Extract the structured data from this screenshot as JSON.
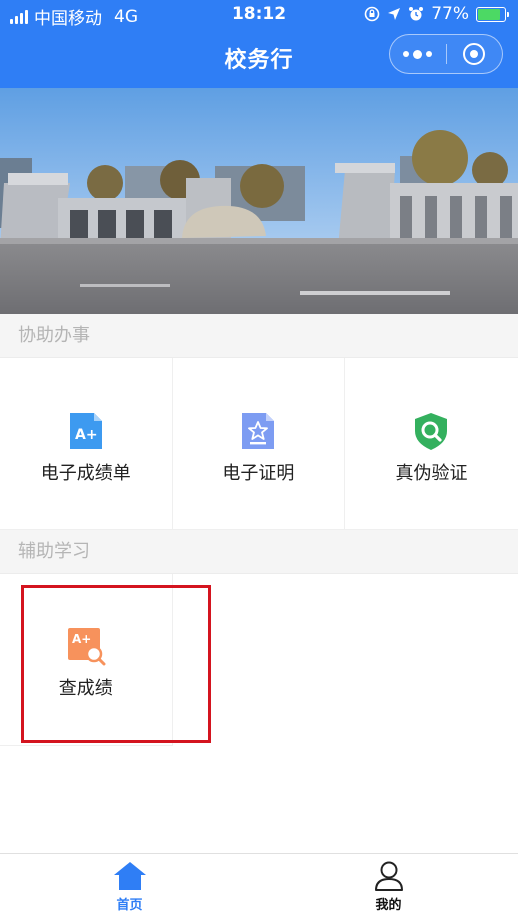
{
  "status_bar": {
    "carrier": "中国移动",
    "network": "4G",
    "time": "18:12",
    "battery_percent": "77%",
    "battery_level": 0.77,
    "battery_color": "#4cd964"
  },
  "nav": {
    "title": "校务行",
    "background": "#2f7ef5"
  },
  "sections": [
    {
      "title": "协助办事",
      "items": [
        {
          "label": "电子成绩单",
          "icon": "transcript-icon"
        },
        {
          "label": "电子证明",
          "icon": "certificate-icon"
        },
        {
          "label": "真伪验证",
          "icon": "verify-shield-icon"
        }
      ]
    },
    {
      "title": "辅助学习",
      "items": [
        {
          "label": "查成绩",
          "icon": "grade-search-icon"
        }
      ]
    }
  ],
  "tabs": [
    {
      "label": "首页",
      "icon": "home-icon",
      "active": true
    },
    {
      "label": "我的",
      "icon": "profile-icon",
      "active": false
    }
  ],
  "colors": {
    "accent": "#2f7ef5",
    "highlight": "#d4141f"
  }
}
